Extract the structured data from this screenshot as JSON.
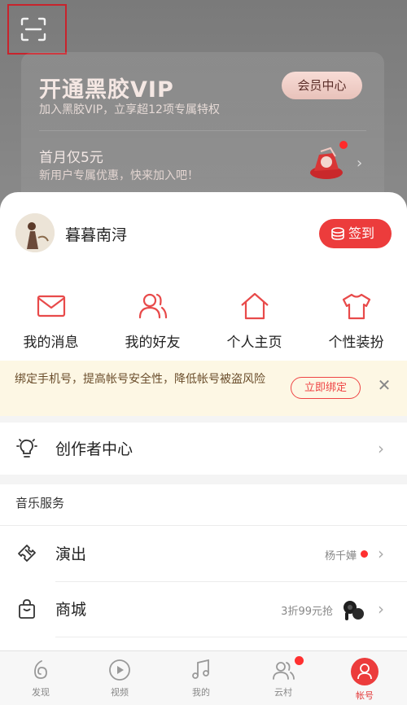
{
  "header": {
    "scan_icon": "scan-icon"
  },
  "vip": {
    "title": "开通黑胶VIP",
    "subtitle": "加入黑胶VIP，立享超12项专属特权",
    "center_button": "会员中心",
    "promo_title": "首月仅5元",
    "promo_subtitle": "新用户专属优惠，快来加入吧！"
  },
  "profile": {
    "username": "暮暮南浔",
    "checkin_label": "签到"
  },
  "quick_actions": [
    {
      "label": "我的消息",
      "icon": "envelope-icon"
    },
    {
      "label": "我的好友",
      "icon": "friends-icon"
    },
    {
      "label": "个人主页",
      "icon": "home-icon"
    },
    {
      "label": "个性装扮",
      "icon": "tshirt-icon"
    }
  ],
  "notice": {
    "text": "绑定手机号，提高帐号安全性，降低帐号被盗风险",
    "button": "立即绑定"
  },
  "creator": {
    "label": "创作者中心"
  },
  "music_services": {
    "title": "音乐服务",
    "items": [
      {
        "label": "演出",
        "right_text": "杨千嬅",
        "icon": "ticket-icon"
      },
      {
        "label": "商城",
        "right_text": "3折99元抢",
        "icon": "shopping-bag-icon"
      }
    ]
  },
  "tabbar": [
    {
      "label": "发现",
      "icon": "discover-icon",
      "active": false
    },
    {
      "label": "视频",
      "icon": "video-icon",
      "active": false
    },
    {
      "label": "我的",
      "icon": "music-note-icon",
      "active": false
    },
    {
      "label": "云村",
      "icon": "community-icon",
      "active": false
    },
    {
      "label": "帐号",
      "icon": "account-icon",
      "active": true
    }
  ],
  "colors": {
    "accent": "#ec3c3c",
    "notice_bg": "#fdf7e4"
  }
}
